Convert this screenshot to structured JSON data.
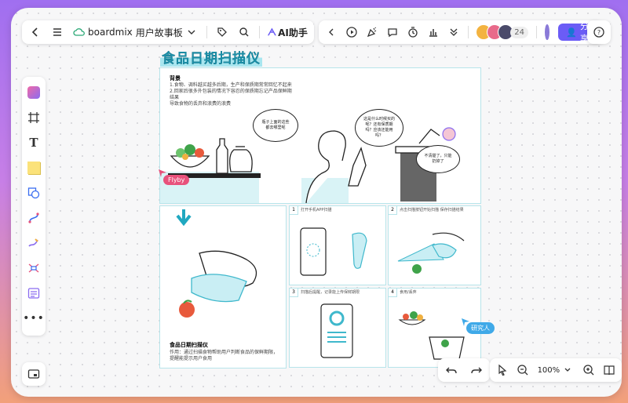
{
  "app": {
    "brand": "boardmix",
    "file_name": "用户故事板"
  },
  "toolbar": {
    "ai_label": "AI助手",
    "collaborator_count": "24",
    "share_label": "分享"
  },
  "zoom": {
    "level": "100%"
  },
  "board": {
    "title": "食品日期扫描仪",
    "background_heading": "背景",
    "background_lines": [
      "1.食物、调料越买越多后期，生产和保质期常常回忆不起来",
      "2.回家后很多外包装的情况下容忍的保质期忘记产品保鲜期",
      "结果",
      "导致食物的丢弃和浪费的浪费"
    ],
    "bubble_1": "瓶子上面的这些都去哪里呢",
    "bubble_2": "这是什么时候买的呢？还有保质期吗？应该还能用吗？",
    "bubble_3": "不清楚了，只能扔掉了",
    "product_title": "食品日期扫描仪",
    "product_desc": "作用：通过扫描食物帮助用户判断食品的保鲜期限，提醒能提示用户食用",
    "panels": [
      {
        "num": "1",
        "caption": "打开手机APP扫描"
      },
      {
        "num": "2",
        "caption": "点击扫描按钮开始扫描  保存扫描结果"
      },
      {
        "num": "3",
        "caption": "扫描后提醒，记录能上传保鲜期限"
      },
      {
        "num": "4",
        "caption": "食用/丢弃"
      }
    ]
  },
  "cursors": {
    "user_1": "Flyby",
    "user_2": "研究人"
  },
  "colors": {
    "accent": "#6b5cf6",
    "teal": "#1b8fa8",
    "flyby_tag": "#e8527c",
    "research_tag": "#3fa9e8"
  }
}
